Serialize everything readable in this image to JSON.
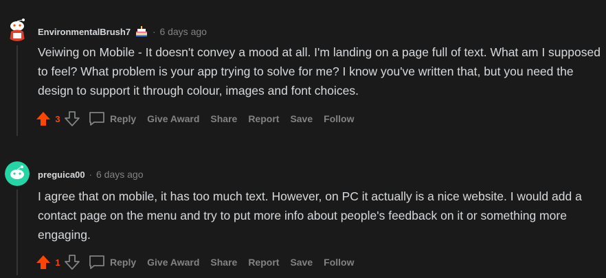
{
  "comments": [
    {
      "username": "EnvironmentalBrush7",
      "has_flair": true,
      "time": "6 days ago",
      "body": "Veiwing on Mobile - It doesn't convey a mood at all. I'm landing on a page full of text. What am I supposed to feel? What problem is your app trying to solve for me? I know you've written that, but you need the design to support it through colour, images and font choices.",
      "votes": "3",
      "avatar_icon": "snoo-avatar-icon"
    },
    {
      "username": "preguica00",
      "has_flair": false,
      "time": "6 days ago",
      "body": "I agree that on mobile, it has too much text. However, on PC it actually is a nice website. I would add a contact page on the menu and try to put more info about people's feedback on it or something more engaging.",
      "votes": "1",
      "avatar_icon": "default-snoo-avatar-icon"
    }
  ],
  "separator": "·",
  "actions": {
    "reply": "Reply",
    "give_award": "Give Award",
    "share": "Share",
    "report": "Report",
    "save": "Save",
    "follow": "Follow"
  },
  "colors": {
    "background": "#1a1a1b",
    "upvote": "#ff4500",
    "muted": "#818384",
    "text": "#d7dadc",
    "avatar2": "#24d6a5"
  }
}
